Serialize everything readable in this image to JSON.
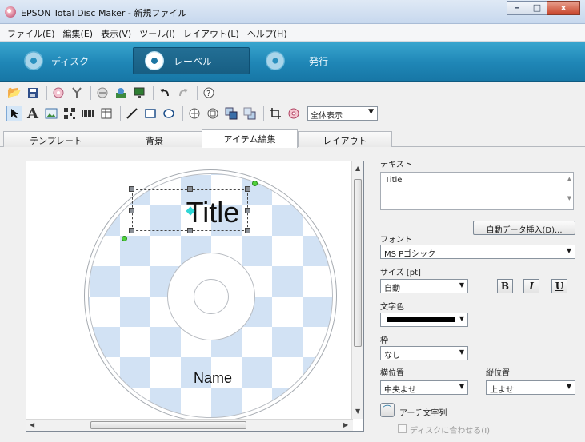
{
  "window": {
    "title": "EPSON Total Disc Maker - 新規ファイル",
    "buttons": {
      "minimize": "–",
      "maximize": "□",
      "close": "x"
    }
  },
  "menu": [
    "ファイル(E)",
    "編集(E)",
    "表示(V)",
    "ツール(I)",
    "レイアウト(L)",
    "ヘルプ(H)"
  ],
  "modes": {
    "disc": "ディスク",
    "label": "レーベル",
    "publish": "発行"
  },
  "toolbar2": {
    "zoom": "全体表示"
  },
  "tabs": [
    "テンプレート",
    "背景",
    "アイテム編集",
    "レイアウト"
  ],
  "canvas": {
    "title_text": "Title",
    "name_text": "Name"
  },
  "props": {
    "text_label": "テキスト",
    "text_value": "Title",
    "auto_insert_button": "自動データ挿入(D)...",
    "font_label": "フォント",
    "font_value": "MS Pゴシック",
    "size_label": "サイズ [pt]",
    "size_value": "自動",
    "bold": "B",
    "italic": "I",
    "underline": "U",
    "color_label": "文字色",
    "frame_label": "枠",
    "frame_value": "なし",
    "halign_label": "横位置",
    "halign_value": "中央よせ",
    "valign_label": "縦位置",
    "valign_value": "上よせ",
    "arch_label": "アーチ文字列",
    "fit_disc_label": "ディスクに合わせる(I)",
    "text_color": "#000000"
  },
  "colors": {
    "accent": "#1f86b6",
    "checker": "#d2e2f4",
    "handle": "#4fd13c"
  }
}
